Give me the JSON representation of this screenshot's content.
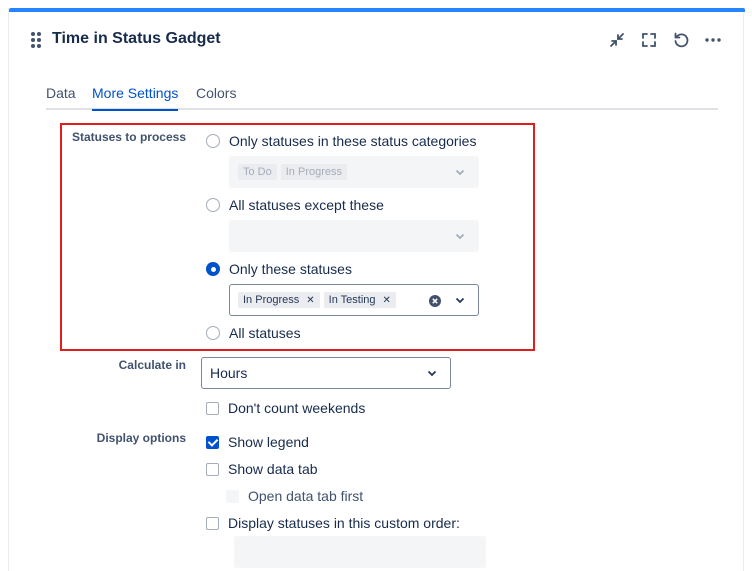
{
  "gadget": {
    "title": "Time in Status Gadget"
  },
  "header_icons": [
    "collapse-icon",
    "fullscreen-icon",
    "refresh-icon",
    "more-icon"
  ],
  "tabs": [
    {
      "label": "Data",
      "active": false
    },
    {
      "label": "More Settings",
      "active": true
    },
    {
      "label": "Colors",
      "active": false
    }
  ],
  "statuses": {
    "label": "Statuses to process",
    "options": [
      {
        "label": "Only statuses in these status categories",
        "checked": false
      },
      {
        "label": "All statuses except these",
        "checked": false
      },
      {
        "label": "Only these statuses",
        "checked": true
      },
      {
        "label": "All statuses",
        "checked": false
      }
    ],
    "categories_select": {
      "chips": [
        "To Do",
        "In Progress"
      ]
    },
    "only_select": {
      "chips": [
        "In Progress",
        "In Testing"
      ]
    }
  },
  "calculate": {
    "label": "Calculate in",
    "value": "Hours",
    "dont_count_weekends": "Don't count weekends"
  },
  "display": {
    "label": "Display options",
    "show_legend": "Show legend",
    "show_data_tab": "Show data tab",
    "open_data_tab_first": "Open data tab first",
    "custom_order": "Display statuses in this custom order:"
  },
  "colors": {
    "accent": "#0052cc",
    "top_bar": "#2684ff",
    "highlight": "#e01e1e"
  }
}
